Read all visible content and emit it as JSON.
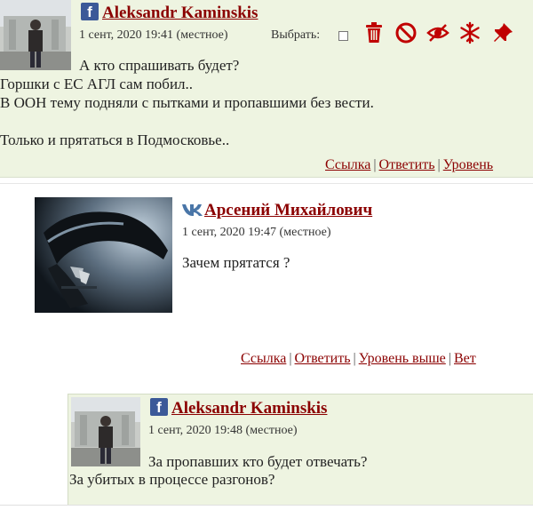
{
  "comments": [
    {
      "author": "Aleksandr Kaminskis",
      "network_icon": "facebook-icon",
      "date": "1 сент, 2020 19:41 (местное)",
      "select_label": "Выбрать:",
      "lines": [
        "А кто спрашивать будет?",
        "Горшки с ЕС АГЛ сам побил..",
        "В ООН тему подняли с пытками и пропавшими без вести.",
        "",
        "Только и прятаться в Подмосковье.."
      ],
      "actions": [
        "Ссылка",
        "Ответить",
        "Уровень"
      ],
      "tools": [
        "trash-icon",
        "ban-icon",
        "hide-eye-icon",
        "freeze-snowflake-icon",
        "pin-icon"
      ]
    },
    {
      "author": "Арсений Михайлович",
      "network_icon": "vk-icon",
      "date": "1 сент, 2020 19:47 (местное)",
      "lines": [
        "Зачем прятатся ?"
      ],
      "actions": [
        "Ссылка",
        "Ответить",
        "Уровень выше",
        "Вет"
      ]
    },
    {
      "author": "Aleksandr Kaminskis",
      "network_icon": "facebook-icon",
      "date": "1 сент, 2020 19:48 (местное)",
      "lines": [
        "За пропавших кто будет отвечать?",
        "За убитых в процессе разгонов?"
      ]
    }
  ],
  "colors": {
    "accent": "#8b0000",
    "comment_bg": "#eef4e1",
    "facebook": "#3b5998",
    "vk": "#4a76a8"
  }
}
